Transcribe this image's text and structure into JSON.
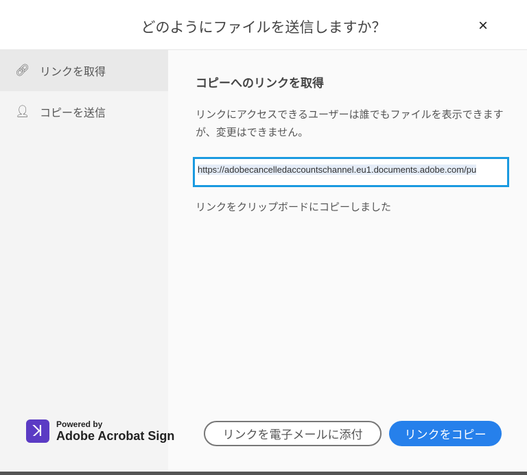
{
  "dialog": {
    "title": "どのようにファイルを送信しますか？",
    "close_icon": "×"
  },
  "sidebar": {
    "items": [
      {
        "label": "リンクを取得",
        "icon": "link-icon",
        "selected": true
      },
      {
        "label": "コピーを送信",
        "icon": "add-user-icon",
        "selected": false
      }
    ]
  },
  "main": {
    "heading": "コピーへのリンクを取得",
    "description": "リンクにアクセスできるユーザーは誰でもファイルを表示できますが、変更はできません。",
    "url": "https://adobecancelledaccountschannel.eu1.documents.adobe.com/pu",
    "status": "リンクをクリップボードにコピーしました"
  },
  "footer": {
    "powered_by": "Powered by",
    "brand": "Adobe Acrobat Sign",
    "attach_button": "リンクを電子メールに添付",
    "copy_button": "リンクをコピー"
  },
  "colors": {
    "accent": "#2680eb",
    "url_border": "#1a9ae0",
    "logo": "#5b3bc4"
  }
}
